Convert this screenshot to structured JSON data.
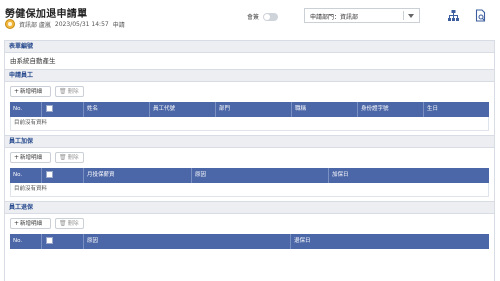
{
  "header": {
    "title": "勞健保加退申請單",
    "user": "資訊部 盧嵐",
    "datetime": "2023/05/31 14:57",
    "action": "申請",
    "toggle_label": "會簽",
    "dept_select": "申請部門：資訊部",
    "icons": [
      "org-chart-icon",
      "document-preview-icon"
    ]
  },
  "form": {
    "section_title": "表單編號",
    "form_number": "由系統自動產生"
  },
  "buttons": {
    "add": "新增明細",
    "delete": "刪除"
  },
  "sections": {
    "applicants": {
      "title": "申請員工",
      "columns": [
        "No.",
        "",
        "姓名",
        "員工代號",
        "部門",
        "職稱",
        "身份證字號",
        "生日"
      ],
      "empty": "目前沒有資料"
    },
    "enroll": {
      "title": "員工加保",
      "columns": [
        "No.",
        "",
        "月投保薪資",
        "原因",
        "加保日"
      ],
      "empty": "目前沒有資料"
    },
    "withdraw": {
      "title": "員工退保",
      "columns": [
        "No.",
        "",
        "原因",
        "退保日"
      ]
    }
  },
  "colors": {
    "table_header": "#4c67a8",
    "section_title": "#274a8e",
    "section_bg": "#eceef1"
  }
}
